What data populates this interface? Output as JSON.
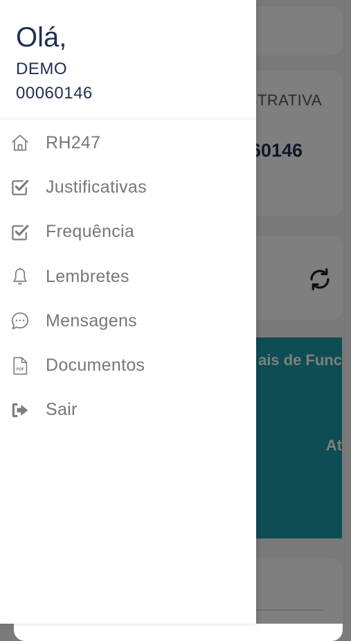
{
  "background": {
    "role_text": "STRATIVA",
    "id_text": "60146",
    "banner_line1": "ais de Func",
    "banner_line2": "At",
    "accent_color": "#1c9aa6"
  },
  "drawer": {
    "greeting": "Olá,",
    "user_name": "DEMO",
    "user_code": "00060146",
    "items": [
      {
        "label": "RH247",
        "icon": "home-icon"
      },
      {
        "label": "Justificativas",
        "icon": "checkbox-icon"
      },
      {
        "label": "Frequência",
        "icon": "checkbox-icon"
      },
      {
        "label": "Lembretes",
        "icon": "bell-icon"
      },
      {
        "label": "Mensagens",
        "icon": "chat-bubble-icon"
      },
      {
        "label": "Documentos",
        "icon": "pdf-file-icon"
      },
      {
        "label": "Sair",
        "icon": "logout-icon"
      }
    ],
    "text_color": "#1e2f52"
  }
}
